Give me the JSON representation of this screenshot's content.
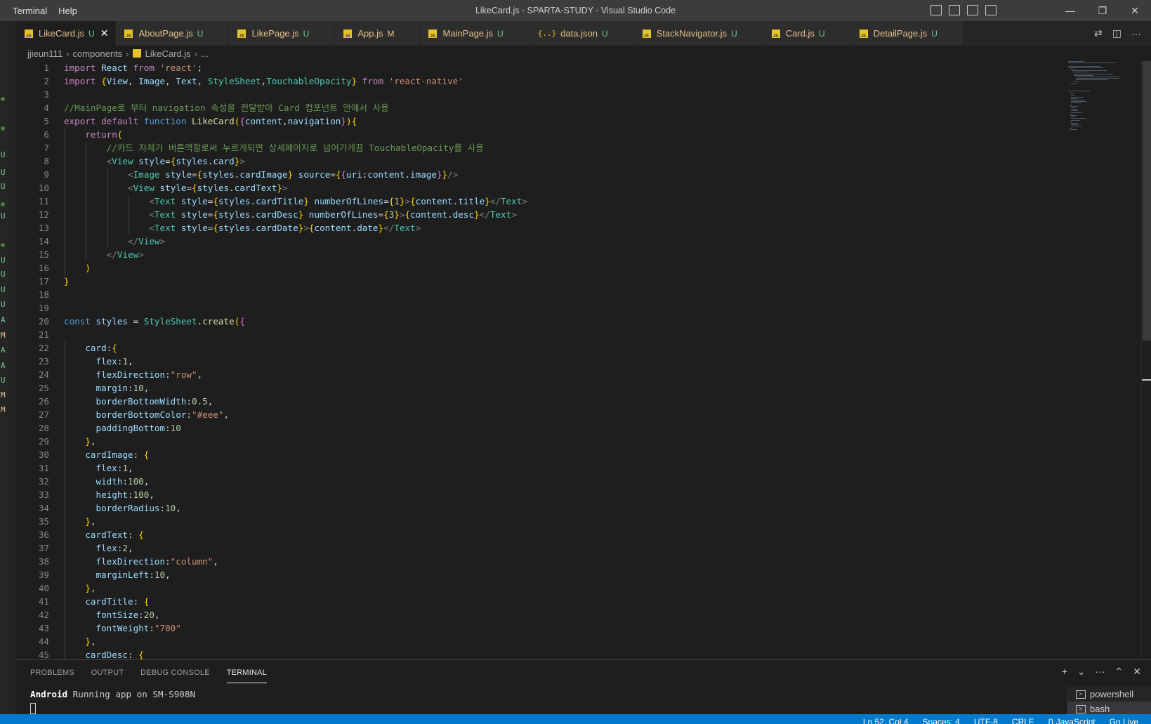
{
  "titlebar": {
    "menu": [
      "Terminal",
      "Help"
    ],
    "title": "LikeCard.js - SPARTA-STUDY - Visual Studio Code",
    "controls": {
      "minimize": "—",
      "restore": "❐",
      "close": "✕"
    }
  },
  "tabs": [
    {
      "label": "LikeCard.js",
      "badge": "U",
      "active": true,
      "icon": "js-file-icon"
    },
    {
      "label": "AboutPage.js",
      "badge": "U",
      "icon": "js-file-icon"
    },
    {
      "label": "LikePage.js",
      "badge": "U",
      "icon": "js-file-icon"
    },
    {
      "label": "App.js",
      "badge": "M",
      "icon": "js-file-icon"
    },
    {
      "label": "MainPage.js",
      "badge": "U",
      "icon": "js-file-icon"
    },
    {
      "label": "data.json",
      "badge": "U",
      "icon": "json-file-icon",
      "icon_glyph": "{..}"
    },
    {
      "label": "StackNavigator.js",
      "badge": "U",
      "icon": "js-file-icon"
    },
    {
      "label": "Card.js",
      "badge": "U",
      "icon": "js-file-icon"
    },
    {
      "label": "DetailPage.js",
      "badge": "U",
      "icon": "js-file-icon"
    }
  ],
  "breadcrumb": [
    "jjieun111",
    "components",
    "LikeCard.js",
    "..."
  ],
  "activity_marks": [
    "•",
    "•",
    "U",
    "U",
    "U",
    "•",
    "U",
    "•",
    "U",
    "U",
    "U",
    "U",
    "A",
    "M",
    "A",
    "A",
    "U",
    "M",
    "M"
  ],
  "code_lines": [
    "import React from 'react';",
    "import {View, Image, Text, StyleSheet,TouchableOpacity} from 'react-native'",
    "",
    "//MainPage로 부터 navigation 속성을 전달받아 Card 컴포넌트 안에서 사용",
    "export default function LikeCard({content,navigation}){",
    "    return(",
    "        //카드 자체가 버튼역할로써 누르게되면 상세페이지로 넘어가게끔 TouchableOpacity를 사용",
    "        <View style={styles.card}>",
    "            <Image style={styles.cardImage} source={{uri:content.image}}/>",
    "            <View style={styles.cardText}>",
    "                <Text style={styles.cardTitle} numberOfLines={1}>{content.title}</Text>",
    "                <Text style={styles.cardDesc} numberOfLines={3}>{content.desc}</Text>",
    "                <Text style={styles.cardDate}>{content.date}</Text>",
    "            </View>",
    "        </View>",
    "    )",
    "}",
    "",
    "",
    "const styles = StyleSheet.create({",
    "",
    "    card:{",
    "      flex:1,",
    "      flexDirection:\"row\",",
    "      margin:10,",
    "      borderBottomWidth:0.5,",
    "      borderBottomColor:\"#eee\",",
    "      paddingBottom:10",
    "    },",
    "    cardImage: {",
    "      flex:1,",
    "      width:100,",
    "      height:100,",
    "      borderRadius:10,",
    "    },",
    "    cardText: {",
    "      flex:2,",
    "      flexDirection:\"column\",",
    "      marginLeft:10,",
    "    },",
    "    cardTitle: {",
    "      fontSize:20,",
    "      fontWeight:\"700\"",
    "    },",
    "    cardDesc: {"
  ],
  "panel": {
    "tabs": [
      "PROBLEMS",
      "OUTPUT",
      "DEBUG CONSOLE",
      "TERMINAL"
    ],
    "active_tab": "TERMINAL",
    "terminal_prefix": "Android",
    "terminal_text": " Running app on SM-S908N",
    "terminals": [
      "powershell",
      "bash"
    ],
    "actions": {
      "add": "+",
      "split": "⌄",
      "more": "···",
      "maximize": "⌃",
      "close": "✕"
    }
  },
  "statusbar": [
    "Ln 52, Col 4",
    "Spaces: 4",
    "UTF-8",
    "CRLF",
    "{} JavaScript",
    "Go Live"
  ],
  "colors": {
    "statusbar": "#007acc",
    "titlebar": "#3c3c3c",
    "editor_bg": "#1e1e1e",
    "untracked": "#73c991",
    "modified": "#e2c08d"
  }
}
